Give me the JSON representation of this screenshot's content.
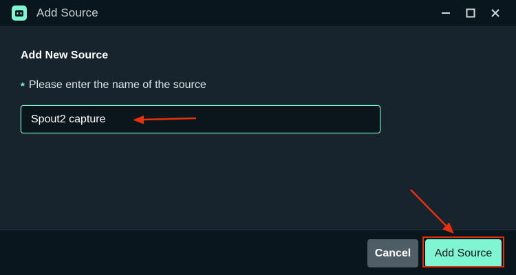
{
  "window": {
    "title": "Add Source",
    "app_icon": "streamlabs-robot-icon",
    "controls": [
      "minimize-icon",
      "maximize-icon",
      "close-icon"
    ]
  },
  "form": {
    "heading": "Add New Source",
    "required_marker": "*",
    "label": "Please enter the name of the source",
    "name_value": "Spout2 capture"
  },
  "footer": {
    "cancel_label": "Cancel",
    "add_label": "Add Source"
  },
  "colors": {
    "accent": "#80f5d2",
    "background": "#17242d",
    "titlebar": "#09161d",
    "annotation": "#e8300b"
  }
}
